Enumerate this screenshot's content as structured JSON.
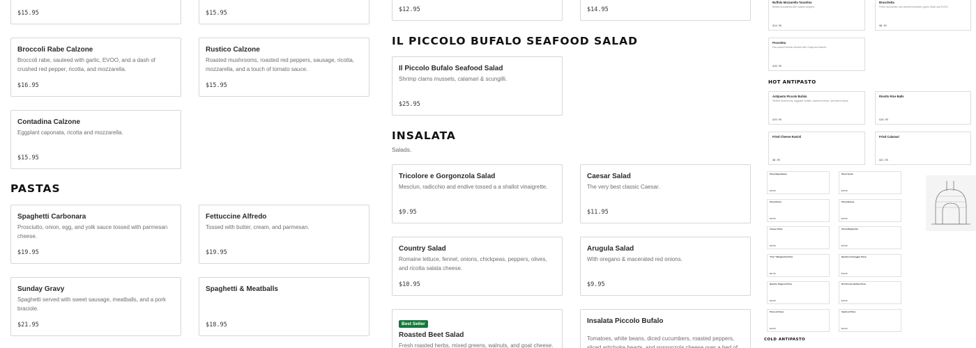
{
  "col1": {
    "top_prices": [
      "$15.95",
      "$15.95"
    ],
    "calzones": [
      {
        "name": "Broccoli Rabe Calzone",
        "desc": "Broccoli rabe, sauteed with garlic, EVOO, and a dash of crushed red pepper, ricotta, and mozzarella.",
        "price": "$16.95"
      },
      {
        "name": "Rustico Calzone",
        "desc": "Roasted mushrooms, roasted red peppers, sausage, ricotta, mozzarella, and a touch of tomato sauce.",
        "price": "$15.95"
      },
      {
        "name": "Contadina Calzone",
        "desc": "Eggplant caponata, ricotta and mozzarella.",
        "price": "$15.95"
      }
    ],
    "pastas_heading": "PASTAS",
    "pastas": [
      {
        "name": "Spaghetti Carbonara",
        "desc": "Prosciutto, onion, egg, and yolk sauce tossed with parmesan cheese.",
        "price": "$19.95"
      },
      {
        "name": "Fettuccine Alfredo",
        "desc": "Tossed with butter, cream, and parmesan.",
        "price": "$19.95"
      },
      {
        "name": "Sunday Gravy",
        "desc": "Spaghetti served with sweet sausage, meatballs, and a pork braciole.",
        "price": "$21.95"
      },
      {
        "name": "Spaghetti & Meatballs",
        "desc": "",
        "price": "$18.95"
      }
    ]
  },
  "col2": {
    "top_prices": [
      "$12.95",
      "$14.95"
    ],
    "seafood_heading": "IL PICCOLO BUFALO SEAFOOD SALAD",
    "seafood": {
      "name": "Il Piccolo Bufalo Seafood Salad",
      "desc": "Shrimp clams mussels, calamari & scungilli.",
      "price": "$25.95"
    },
    "insalata_heading": "INSALATA",
    "insalata_sub": "Salads.",
    "salads": [
      {
        "name": "Tricolore e Gorgonzola Salad",
        "desc": "Mesclun, radicchio and endive tossed a a shallot vinaigrette.",
        "price": "$9.95"
      },
      {
        "name": "Caesar Salad",
        "desc": "The very best classic Caesar.",
        "price": "$11.95"
      },
      {
        "name": "Country Salad",
        "desc": "Romaine lettuce, fennel, onions, chickpeas, peppers, olives, and ricotta salata cheese.",
        "price": "$10.95"
      },
      {
        "name": "Arugula Salad",
        "desc": "With oregano & macerated red onions.",
        "price": "$9.95"
      },
      {
        "name": "Roasted Beet Salad",
        "badge": "Best Seller",
        "desc": "Fresh roasted herbs, mixed greens, walnuts, and goat cheese.",
        "price": ""
      },
      {
        "name": "Insalata Piccolo Bufalo",
        "desc": "Tomatoes, white beans, diced cucumbers, roasted peppers, sliced artichoke hearts, and gorgonzola cheese over a bed of...",
        "price": ""
      }
    ]
  },
  "thumb": {
    "top_cards": [
      {
        "name": "Buffalo Mozzarella Tarantina",
        "desc": "Buffalo mozzarella with roasted peppers.",
        "price": "$14.95"
      },
      {
        "name": "Bruschetta",
        "desc": "Fresh mozzarella, vine-ripened tomatoes, garlic, Basil, and EVOO.",
        "price": "$8.95"
      },
      {
        "name": "Provoleta",
        "desc": "Pan-seared cheese drizzled with Grapa and flamed.",
        "price": "$10.95"
      }
    ],
    "hot_heading": "HOT ANTIPASTO",
    "hot_cards": [
      {
        "name": "Antipasto Piccolo Bufalo",
        "desc": "Stuffed mushrooms, eggplant rollatini, sauteed shrimp, and baked clams.",
        "price": "$19.95"
      },
      {
        "name": "Risotto Rice Balls",
        "desc": "",
        "price": "$10.95"
      },
      {
        "name": "Fried Cheese Ravioli",
        "desc": "",
        "price": "$8.95"
      },
      {
        "name": "Fried Calamari",
        "desc": "",
        "price": "$22.95"
      }
    ],
    "pizza_cards": [
      {
        "name": "Pizza Napoletana",
        "price": "$15.95"
      },
      {
        "name": "Pizza Verde",
        "price": "$15.95"
      },
      {
        "name": "Pizza Roma",
        "price": "$15.95"
      },
      {
        "name": "Pizza Bianca",
        "price": "$15.95"
      },
      {
        "name": "Caesar Pizza",
        "price": "$15.95"
      },
      {
        "name": "Pizza Margherita",
        "price": "$15.95"
      },
      {
        "name": "\"Doc\" Margherita Pizza",
        "price": "$21.95"
      },
      {
        "name": "Quattro Formaggio Pizza",
        "price": "$16.95"
      },
      {
        "name": "Quattro Stagioni Pizza",
        "price": "$16.95"
      },
      {
        "name": "Del Piccolo Bufalo Pizza",
        "price": "$16.95"
      },
      {
        "name": "Pizza al Roma",
        "price": "$16.95"
      },
      {
        "name": "Seafood Pizza",
        "price": "$16.95"
      }
    ],
    "cold_heading": "COLD ANTIPASTO"
  }
}
